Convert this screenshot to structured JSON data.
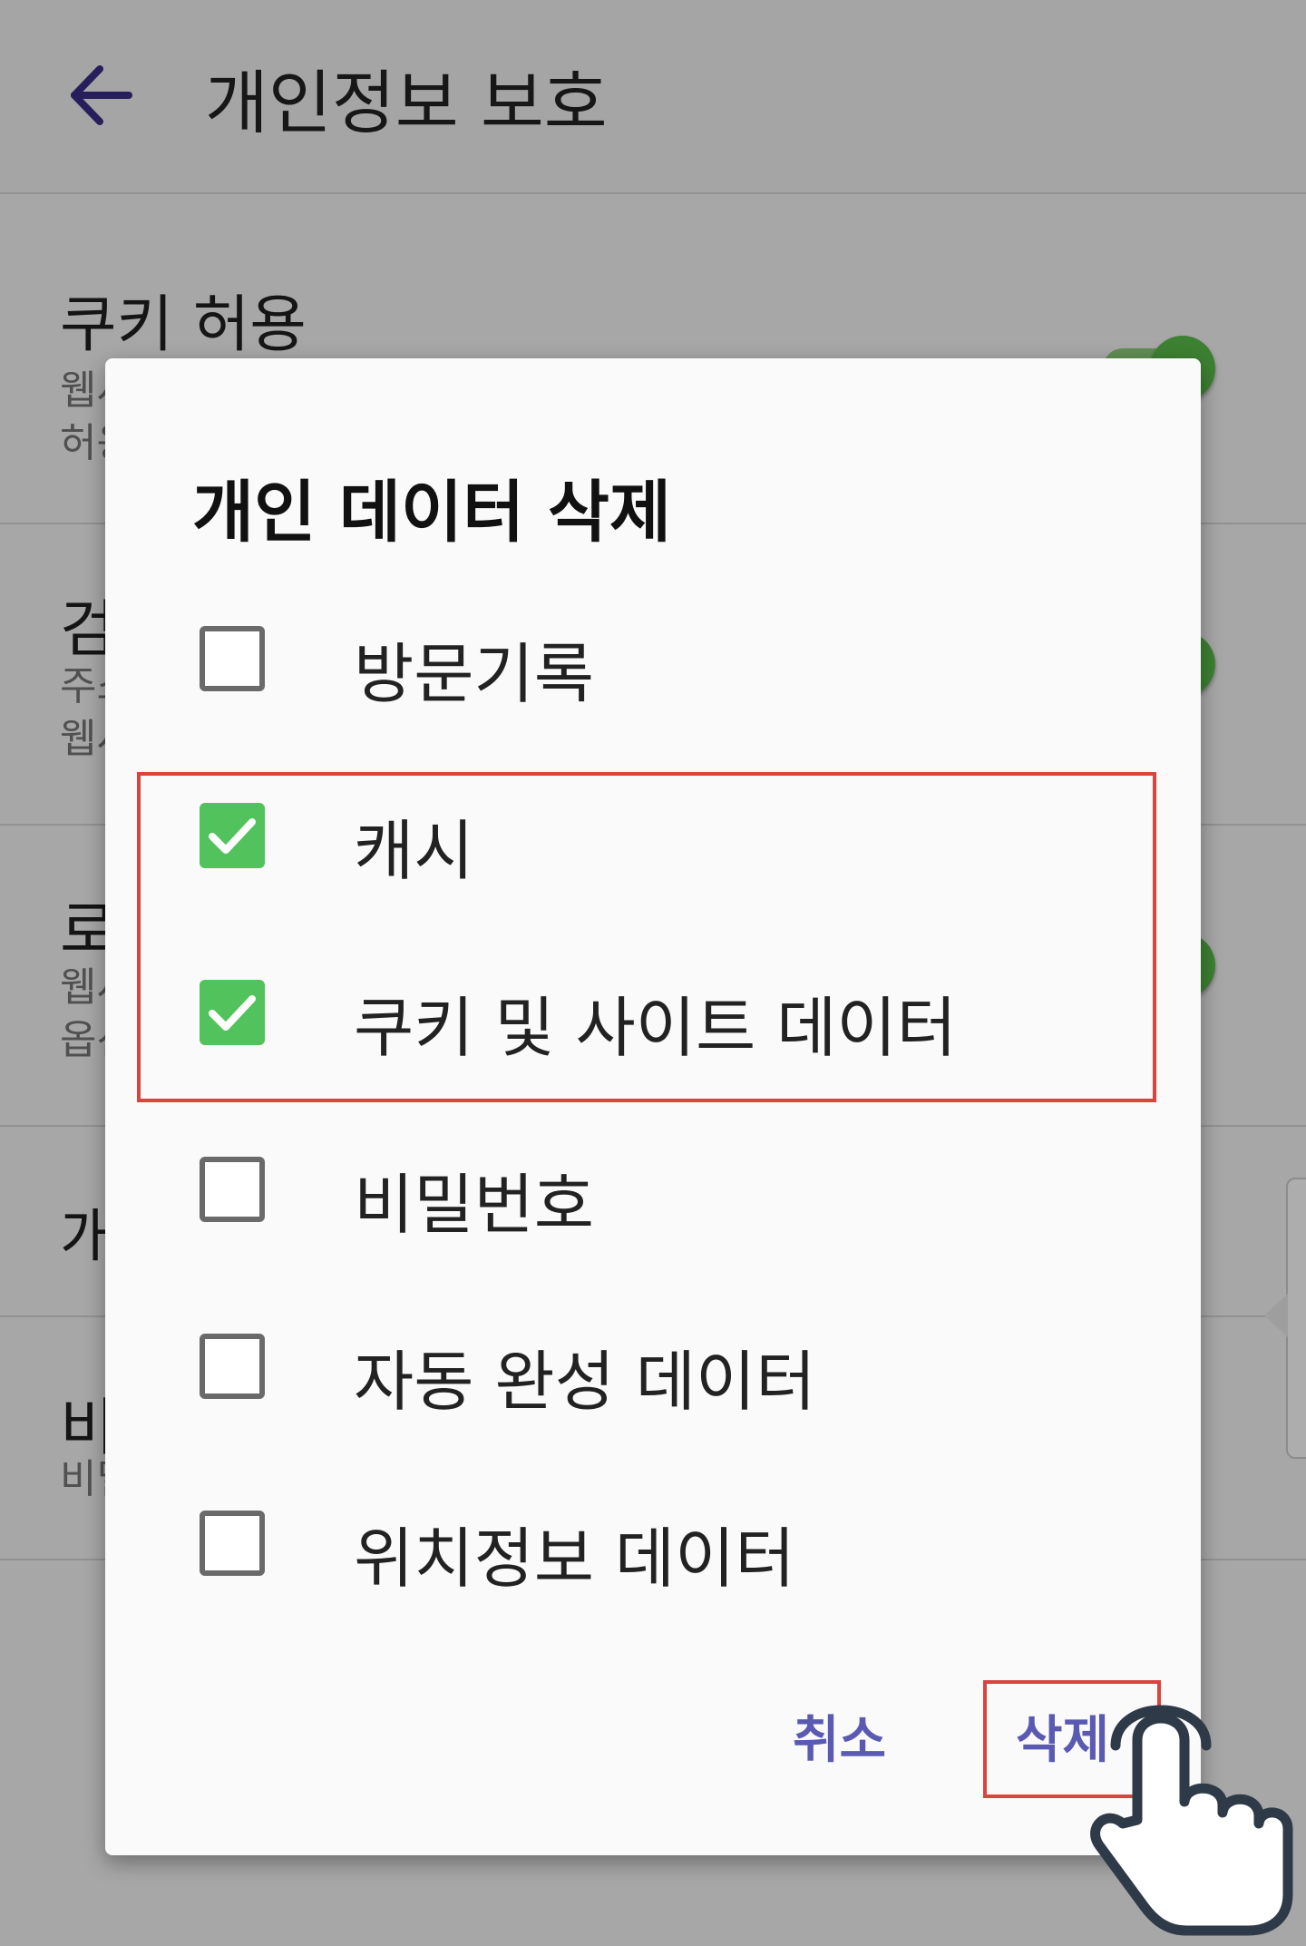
{
  "appbar": {
    "title": "개인정보 보호"
  },
  "background_settings": [
    {
      "title": "쿠키 허용",
      "desc_lines": [
        "웹사",
        "허용"
      ]
    },
    {
      "title": "검색",
      "desc_lines": [
        "주소",
        "웹사"
      ]
    },
    {
      "title": "로그",
      "desc_lines": [
        "웹사",
        "옵션"
      ]
    },
    {
      "title": "개인"
    },
    {
      "title": "비밀",
      "desc_lines": [
        "비밀"
      ]
    }
  ],
  "dialog": {
    "title": "개인 데이터 삭제",
    "options": [
      {
        "label": "방문기록",
        "checked": false
      },
      {
        "label": "캐시",
        "checked": true
      },
      {
        "label": "쿠키 및 사이트 데이터",
        "checked": true
      },
      {
        "label": "비밀번호",
        "checked": false
      },
      {
        "label": "자동 완성 데이터",
        "checked": false
      },
      {
        "label": "위치정보 데이터",
        "checked": false
      }
    ],
    "cancel_label": "취소",
    "delete_label": "삭제"
  },
  "colors": {
    "accent": "#5a5ab3",
    "checked": "#52c25c",
    "highlight": "#d9443f",
    "toggle_on": "#5bbf4a"
  },
  "icons": [
    "back-arrow-icon",
    "checkmark-icon",
    "pointing-hand-icon"
  ]
}
